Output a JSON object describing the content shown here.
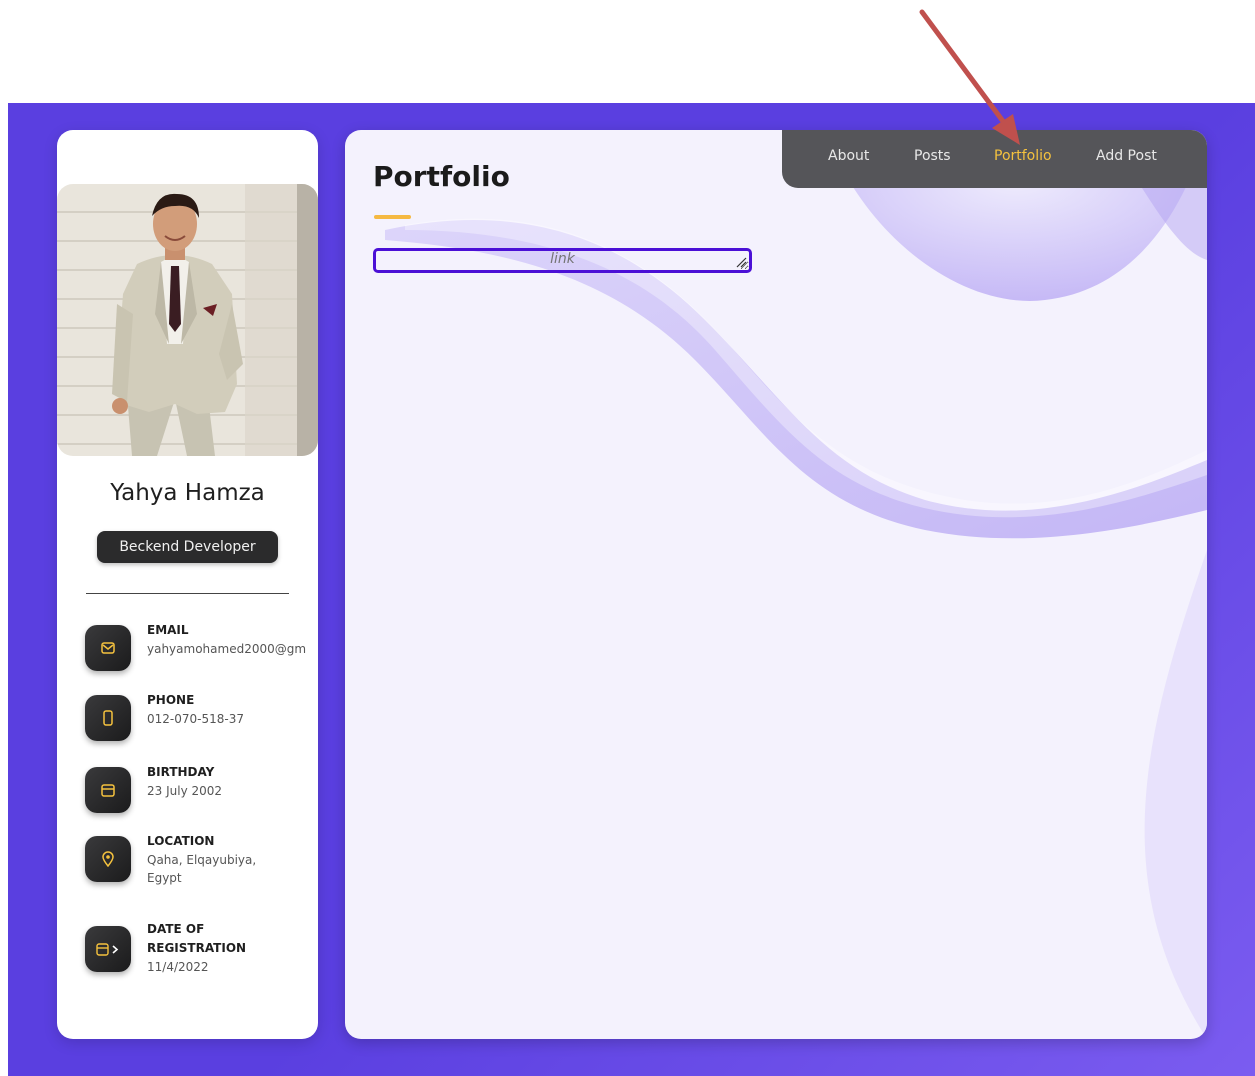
{
  "profile": {
    "name": "Yahya Hamza",
    "role": "Beckend Developer"
  },
  "contacts": [
    {
      "label": "EMAIL",
      "value": "yahyamohamed2000@gm",
      "icon": "mail-icon"
    },
    {
      "label": "PHONE",
      "value": "012-070-518-37",
      "icon": "phone-icon"
    },
    {
      "label": "BIRTHDAY",
      "value": "23 July 2002",
      "icon": "calendar-icon"
    },
    {
      "label": "LOCATION",
      "value": "Qaha, Elqayubiya, Egypt",
      "icon": "location-pin-icon"
    },
    {
      "label": "DATE OF REGISTRATION",
      "value": "11/4/2022",
      "icon": "calendar-arrow-icon"
    }
  ],
  "nav": {
    "items": [
      {
        "label": "About"
      },
      {
        "label": "Posts"
      },
      {
        "label": "Portfolio"
      },
      {
        "label": "Add Post"
      }
    ],
    "active": "Portfolio"
  },
  "main": {
    "title": "Portfolio",
    "link_input": {
      "placeholder": "link",
      "value": ""
    }
  },
  "colors": {
    "background": "#5a3fe0",
    "accent": "#f5c23e",
    "underline": "#f5b942",
    "input_border": "#4b10d6",
    "navbar": "#555559",
    "annotation_arrow": "#c0504d"
  }
}
